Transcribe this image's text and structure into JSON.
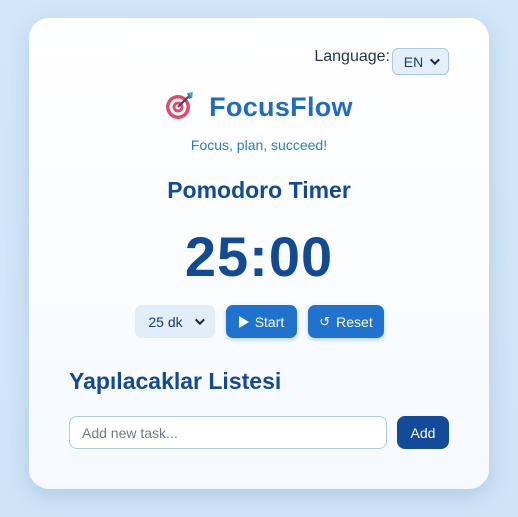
{
  "language": {
    "label": "Language:",
    "selected": "EN"
  },
  "brand": {
    "icon": "target-dart-icon",
    "title": "FocusFlow",
    "tagline": "Focus, plan, succeed!"
  },
  "timer": {
    "title": "Pomodoro Timer",
    "display": "25:00",
    "duration_selected": "25 dk",
    "start_label": "Start",
    "reset_label": "Reset",
    "reset_glyph": "↺"
  },
  "todo": {
    "title": "Yapılacaklar Listesi",
    "input_placeholder": "Add new task...",
    "input_value": "",
    "add_label": "Add"
  },
  "colors": {
    "primary": "#1f73cf",
    "heading": "#124a94",
    "brand": "#1f6cc2",
    "add_button": "#134a9a"
  }
}
